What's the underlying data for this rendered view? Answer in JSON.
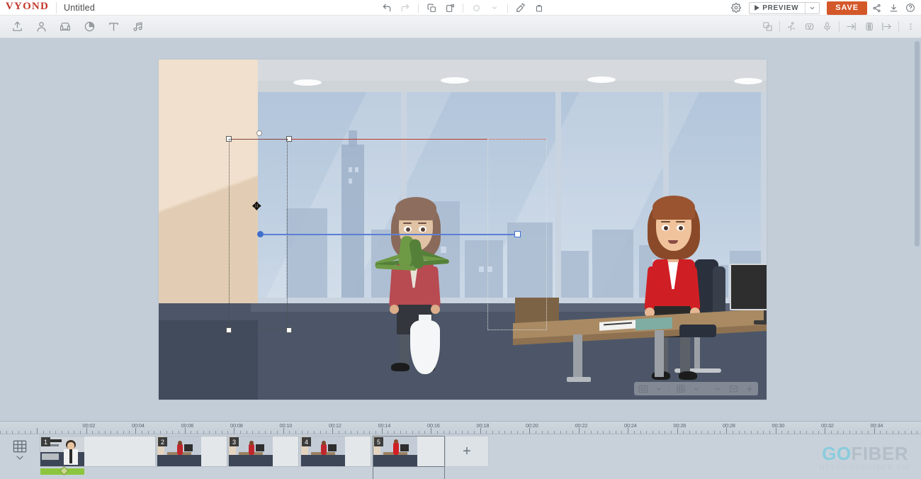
{
  "app": {
    "brand": "VYOND",
    "document_title": "Untitled"
  },
  "topbar": {
    "undo_label": "Undo",
    "redo_label": "Redo",
    "copy_label": "Copy",
    "paste_label": "Paste",
    "duplicate_label": "Duplicate",
    "format_paint_label": "Format painter",
    "delete_label": "Delete",
    "settings_label": "Settings",
    "preview_label": "PREVIEW",
    "preview_caret_label": "Preview options",
    "save_label": "SAVE",
    "share_label": "Share",
    "download_label": "Download",
    "help_label": "Help",
    "save_color": "#d4572a"
  },
  "toolbar": {
    "left_items": [
      {
        "name": "upload-icon",
        "label": "Upload"
      },
      {
        "name": "character-icon",
        "label": "Characters"
      },
      {
        "name": "props-icon",
        "label": "Props"
      },
      {
        "name": "charts-icon",
        "label": "Charts"
      },
      {
        "name": "text-icon",
        "label": "Text"
      },
      {
        "name": "audio-icon",
        "label": "Audio"
      }
    ],
    "right_items": [
      {
        "name": "swap-image-icon",
        "label": "Swap"
      },
      {
        "name": "action-icon",
        "label": "Actions"
      },
      {
        "name": "expression-icon",
        "label": "Expressions"
      },
      {
        "name": "microphone-icon",
        "label": "Record voice"
      },
      {
        "name": "enter-icon",
        "label": "Enter effect"
      },
      {
        "name": "motion-icon",
        "label": "Motion path"
      },
      {
        "name": "exit-icon",
        "label": "Exit effect"
      },
      {
        "name": "more-icon",
        "label": "More options"
      }
    ]
  },
  "canvas": {
    "scene_title": "Office scene",
    "selected_object": "character-left",
    "controls": {
      "frame_label": "Frame",
      "frame_caret": "Frame options",
      "grid_label": "Grid",
      "grid_caret": "Grid options",
      "zoom_out_label": "−",
      "fit_label": "Fit to screen",
      "zoom_in_label": "+"
    }
  },
  "timeline": {
    "scene_list_label": "Scenes",
    "add_scene_label": "+",
    "timecodes": [
      "00:02",
      "00:04",
      "00:06",
      "00:08",
      "00:10",
      "00:12",
      "00:14",
      "00:16",
      "00:18",
      "00:20",
      "00:22",
      "00:24",
      "00:26",
      "00:28",
      "00:30",
      "00:32",
      "00:34"
    ],
    "scenes": [
      {
        "number": "1",
        "selected": false,
        "has_audio": true
      },
      {
        "number": "2",
        "selected": false,
        "has_audio": false
      },
      {
        "number": "3",
        "selected": false,
        "has_audio": false
      },
      {
        "number": "4",
        "selected": false,
        "has_audio": false
      },
      {
        "number": "5",
        "selected": true,
        "has_audio": false
      }
    ]
  },
  "watermark": {
    "text_primary": "GO",
    "text_secondary": "FIBER",
    "url": "HTTPS://GOFIBER.VN/",
    "color_primary": "#35c6e0",
    "color_secondary": "#9aa5b0"
  }
}
